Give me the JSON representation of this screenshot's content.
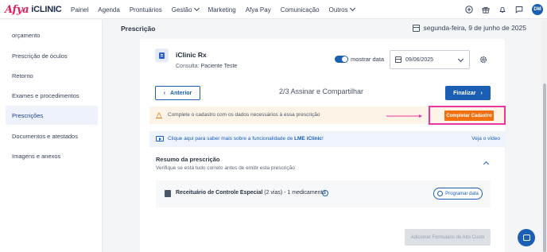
{
  "brand": {
    "afya": "Afya",
    "iclinic": "iCLINIC"
  },
  "nav": [
    {
      "label": "Painel",
      "dropdown": false
    },
    {
      "label": "Agenda",
      "dropdown": false
    },
    {
      "label": "Prontuários",
      "dropdown": false
    },
    {
      "label": "Gestão",
      "dropdown": true
    },
    {
      "label": "Marketing",
      "dropdown": false
    },
    {
      "label": "Afya Pay",
      "dropdown": false
    },
    {
      "label": "Comunicação",
      "dropdown": false
    },
    {
      "label": "Outros",
      "dropdown": true
    }
  ],
  "user": {
    "initials": "DM"
  },
  "sidebar": {
    "items": [
      {
        "label": "orçamento"
      },
      {
        "label": "Prescrição de óculos"
      },
      {
        "label": "Retorno"
      },
      {
        "label": "Exames e procedimentos"
      },
      {
        "label": "Prescrições",
        "active": true
      },
      {
        "label": "Documentos e atestados"
      },
      {
        "label": "Imagens e anexos"
      }
    ]
  },
  "header": {
    "title": "Prescrição",
    "date": "segunda-feira, 9 de junho de 2025"
  },
  "prescription": {
    "title": "iClinic Rx",
    "consult_label": "Consulta:",
    "consult_value": "Paciente Teste",
    "show_date_label": "mostrar data",
    "date_value": "09/06/2025"
  },
  "steps": {
    "back_label": "Anterior",
    "step_text": "2/3 Assinar e Compartilhar",
    "finish_label": "Finalizar"
  },
  "warning": {
    "text": "Complete o cadastro com os dados necessários à essa prescrição",
    "button_label": "Completar Cadastro"
  },
  "info": {
    "text_prefix": "Clique aqui para saber mais sobre a funcionalidade de ",
    "text_bold": "LME iClinic",
    "text_suffix": "!",
    "video_label": "Veja o vídeo"
  },
  "summary": {
    "title": "Resumo da prescrição",
    "subtitle": "Verifique se está tudo correto antes de emitir esta prescrição",
    "item_name": "Receituário de Controle Especial",
    "item_detail": " (2 vias) - 1 medicamento",
    "schedule_label": "Programar data"
  },
  "add_button": "Adicionar Formulário de Alto Custo",
  "colors": {
    "brand_pink": "#e01e5a",
    "primary": "#1a5fb4",
    "orange": "#f07010",
    "highlight": "#e8379e"
  }
}
